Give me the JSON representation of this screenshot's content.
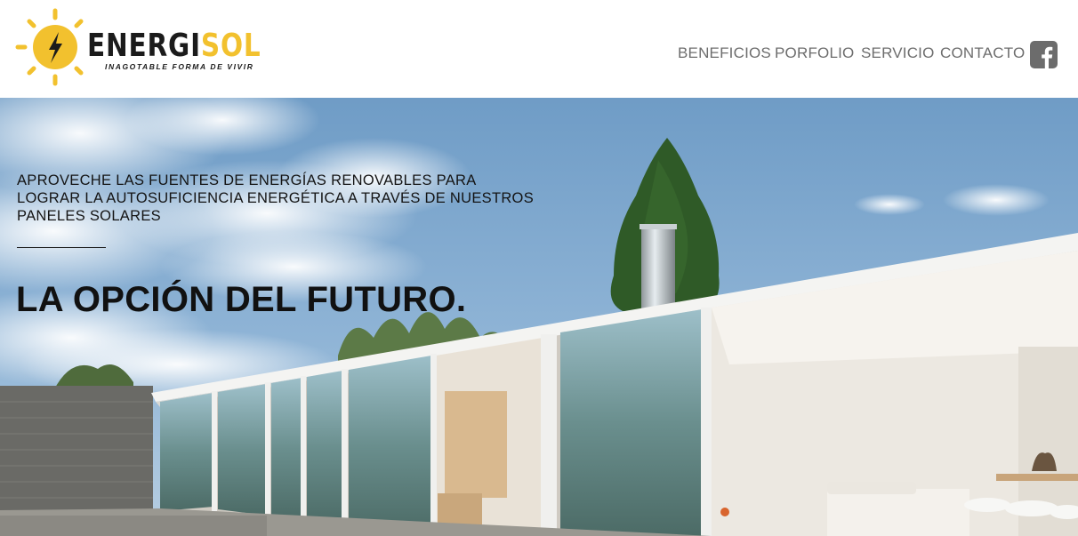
{
  "brand": {
    "name_part1": "ENERGI",
    "name_part2": "SOL",
    "tagline": "INAGOTABLE FORMA DE VIVIR",
    "logo_icon": "sun-bolt-icon",
    "colors": {
      "accent": "#f2c12e",
      "dark": "#1b1b1b"
    }
  },
  "nav": {
    "items": [
      {
        "label": "BENEFICIOS"
      },
      {
        "label": "PORFOLIO"
      },
      {
        "label": "SERVICIO"
      },
      {
        "label": "CONTACTO"
      }
    ],
    "social_icon": "facebook-icon",
    "link_color": "#6d6d6d"
  },
  "hero": {
    "subtitle": "APROVECHE LAS FUENTES DE ENERGÍAS RENOVABLES PARA LOGRAR LA AUTOSUFICIENCIA ENERGÉTICA A TRAVÉS DE NUESTROS PANELES SOLARES",
    "title": "LA OPCIÓN DEL FUTURO.",
    "background": "modern-house-photo"
  }
}
